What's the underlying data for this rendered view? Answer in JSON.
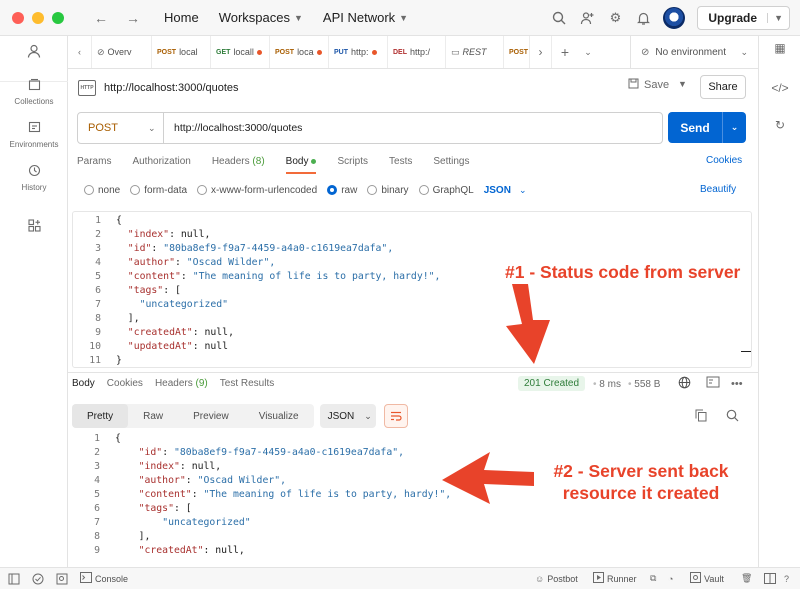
{
  "titlebar": {
    "home": "Home",
    "workspaces": "Workspaces",
    "api_network": "API Network",
    "upgrade": "Upgrade"
  },
  "sidebar": {
    "items": [
      {
        "label": "Collections",
        "icon": "collections-icon"
      },
      {
        "label": "Environments",
        "icon": "environments-icon"
      },
      {
        "label": "History",
        "icon": "history-icon"
      }
    ]
  },
  "tabs": [
    {
      "method": "",
      "label": "Overv",
      "dot": false
    },
    {
      "method": "POST",
      "label": "local",
      "dot": false
    },
    {
      "method": "GET",
      "label": "locall",
      "dot": true
    },
    {
      "method": "POST",
      "label": "loca",
      "dot": true
    },
    {
      "method": "PUT",
      "label": "http:",
      "dot": true
    },
    {
      "method": "DEL",
      "label": "http:/",
      "dot": false
    },
    {
      "method": "",
      "label": "REST",
      "dot": false
    },
    {
      "method": "POST",
      "label": "",
      "dot": false
    }
  ],
  "environment": "No environment",
  "request": {
    "name": "http://localhost:3000/quotes",
    "save": "Save",
    "share": "Share",
    "method": "POST",
    "url": "http://localhost:3000/quotes",
    "send": "Send",
    "tabs": {
      "params": "Params",
      "authorization": "Authorization",
      "headers": "Headers",
      "headers_count": "(8)",
      "body": "Body",
      "scripts": "Scripts",
      "tests": "Tests",
      "settings": "Settings"
    },
    "cookies": "Cookies",
    "body_types": [
      "none",
      "form-data",
      "x-www-form-urlencoded",
      "raw",
      "binary",
      "GraphQL"
    ],
    "selected_body_type": "raw",
    "format": "JSON",
    "beautify": "Beautify"
  },
  "request_body_lines": [
    {
      "n": "1",
      "indent": "",
      "key": "",
      "val": "{",
      "vtype": "n"
    },
    {
      "n": "2",
      "indent": "  ",
      "key": "\"index\"",
      "val": "null,",
      "vtype": "n"
    },
    {
      "n": "3",
      "indent": "  ",
      "key": "\"id\"",
      "val": "\"80ba8ef9-f9a7-4459-a4a0-c1619ea7dafa\",",
      "vtype": "s"
    },
    {
      "n": "4",
      "indent": "  ",
      "key": "\"author\"",
      "val": "\"Oscad Wilder\",",
      "vtype": "s"
    },
    {
      "n": "5",
      "indent": "  ",
      "key": "\"content\"",
      "val": "\"The meaning of life is to party, hardy!\",",
      "vtype": "s"
    },
    {
      "n": "6",
      "indent": "  ",
      "key": "\"tags\"",
      "val": "[",
      "vtype": "n"
    },
    {
      "n": "7",
      "indent": "    ",
      "key": "",
      "val": "\"uncategorized\"",
      "vtype": "s"
    },
    {
      "n": "8",
      "indent": "  ",
      "key": "",
      "val": "],",
      "vtype": "n"
    },
    {
      "n": "9",
      "indent": "  ",
      "key": "\"createdAt\"",
      "val": "null,",
      "vtype": "n"
    },
    {
      "n": "10",
      "indent": "  ",
      "key": "\"updatedAt\"",
      "val": "null",
      "vtype": "n"
    },
    {
      "n": "11",
      "indent": "",
      "key": "",
      "val": "}",
      "vtype": "n"
    }
  ],
  "response": {
    "tabs": [
      "Body",
      "Cookies",
      "Headers",
      "Test Results"
    ],
    "headers_count": "(9)",
    "status": "201 Created",
    "time": "8 ms",
    "size": "558 B",
    "views": [
      "Pretty",
      "Raw",
      "Preview",
      "Visualize"
    ],
    "format": "JSON"
  },
  "response_body_lines": [
    {
      "n": "1",
      "indent": "",
      "key": "",
      "val": "{",
      "vtype": "n"
    },
    {
      "n": "2",
      "indent": "    ",
      "key": "\"id\"",
      "val": "\"80ba8ef9-f9a7-4459-a4a0-c1619ea7dafa\",",
      "vtype": "s"
    },
    {
      "n": "3",
      "indent": "    ",
      "key": "\"index\"",
      "val": "null,",
      "vtype": "n"
    },
    {
      "n": "4",
      "indent": "    ",
      "key": "\"author\"",
      "val": "\"Oscad Wilder\",",
      "vtype": "s"
    },
    {
      "n": "5",
      "indent": "    ",
      "key": "\"content\"",
      "val": "\"The meaning of life is to party, hardy!\",",
      "vtype": "s"
    },
    {
      "n": "6",
      "indent": "    ",
      "key": "\"tags\"",
      "val": "[",
      "vtype": "n"
    },
    {
      "n": "7",
      "indent": "        ",
      "key": "",
      "val": "\"uncategorized\"",
      "vtype": "s"
    },
    {
      "n": "8",
      "indent": "    ",
      "key": "",
      "val": "],",
      "vtype": "n"
    },
    {
      "n": "9",
      "indent": "    ",
      "key": "\"createdAt\"",
      "val": "null,",
      "vtype": "n"
    }
  ],
  "annotations": {
    "one": "#1 - Status code from server",
    "two_line1": "#2 - Server sent back",
    "two_line2": "resource it created"
  },
  "statusbar": {
    "console": "Console",
    "postbot": "Postbot",
    "runner": "Runner",
    "vault": "Vault"
  },
  "colors": {
    "accent": "#0265d2",
    "annotation": "#e8432a",
    "status_ok": "#2f7d3a"
  }
}
